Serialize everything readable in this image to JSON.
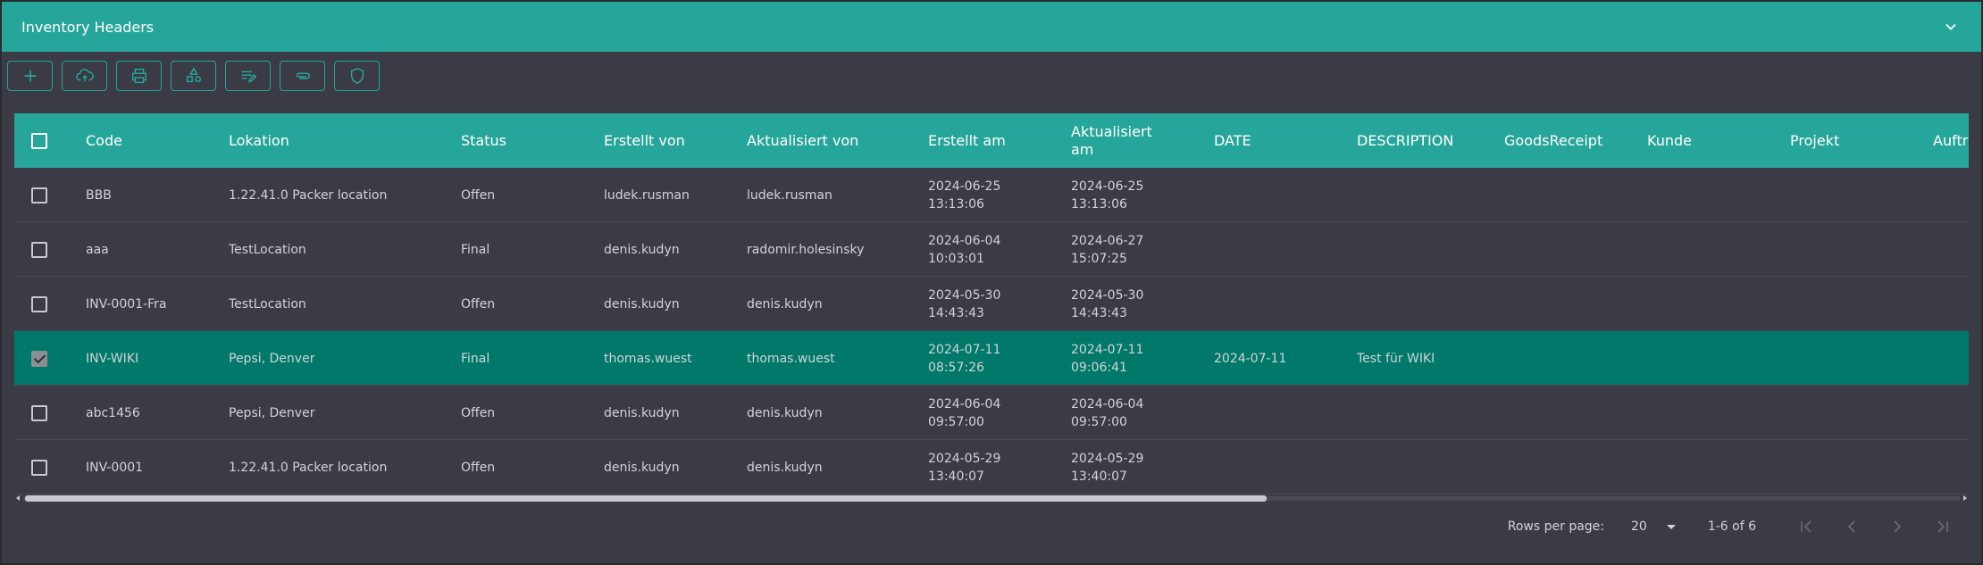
{
  "header": {
    "title": "Inventory Headers"
  },
  "toolbar": {
    "buttons": [
      {
        "name": "add-button",
        "icon": "plus-icon"
      },
      {
        "name": "upload-button",
        "icon": "cloud-upload-icon"
      },
      {
        "name": "print-button",
        "icon": "printer-icon"
      },
      {
        "name": "shapes-button",
        "icon": "shapes-icon"
      },
      {
        "name": "edit-list-button",
        "icon": "edit-list-icon"
      },
      {
        "name": "attach-button",
        "icon": "paperclip-icon"
      },
      {
        "name": "shield-button",
        "icon": "shield-icon"
      }
    ]
  },
  "table": {
    "columns": [
      "Code",
      "Lokation",
      "Status",
      "Erstellt von",
      "Aktualisiert von",
      "Erstellt am",
      "Aktualisiert am",
      "DATE",
      "DESCRIPTION",
      "GoodsReceipt",
      "Kunde",
      "Projekt",
      "Auftr"
    ],
    "rows": [
      {
        "checked": false,
        "cells": [
          "BBB",
          "1.22.41.0 Packer location",
          "Offen",
          "ludek.rusman",
          "ludek.rusman",
          "2024-06-25 13:13:06",
          "2024-06-25 13:13:06",
          "",
          "",
          "",
          "",
          "",
          ""
        ]
      },
      {
        "checked": false,
        "cells": [
          "aaa",
          "TestLocation",
          "Final",
          "denis.kudyn",
          "radomir.holesinsky",
          "2024-06-04 10:03:01",
          "2024-06-27 15:07:25",
          "",
          "",
          "",
          "",
          "",
          ""
        ]
      },
      {
        "checked": false,
        "cells": [
          "INV-0001-Fra",
          "TestLocation",
          "Offen",
          "denis.kudyn",
          "denis.kudyn",
          "2024-05-30 14:43:43",
          "2024-05-30 14:43:43",
          "",
          "",
          "",
          "",
          "",
          ""
        ]
      },
      {
        "checked": true,
        "cells": [
          "INV-WIKI",
          "Pepsi, Denver",
          "Final",
          "thomas.wuest",
          "thomas.wuest",
          "2024-07-11 08:57:26",
          "2024-07-11 09:06:41",
          "2024-07-11",
          "Test für WIKI",
          "",
          "",
          "",
          ""
        ]
      },
      {
        "checked": false,
        "cells": [
          "abc1456",
          "Pepsi, Denver",
          "Offen",
          "denis.kudyn",
          "denis.kudyn",
          "2024-06-04 09:57:00",
          "2024-06-04 09:57:00",
          "",
          "",
          "",
          "",
          "",
          ""
        ]
      },
      {
        "checked": false,
        "cells": [
          "INV-0001",
          "1.22.41.0 Packer location",
          "Offen",
          "denis.kudyn",
          "denis.kudyn",
          "2024-05-29 13:40:07",
          "2024-05-29 13:40:07",
          "",
          "",
          "",
          "",
          "",
          ""
        ]
      }
    ]
  },
  "pager": {
    "rows_per_page_label": "Rows per page:",
    "rows_per_page_value": "20",
    "range": "1-6 of 6"
  },
  "colors": {
    "accent": "#26a69a",
    "selected_row": "#00796b",
    "background": "#3a3b44"
  }
}
